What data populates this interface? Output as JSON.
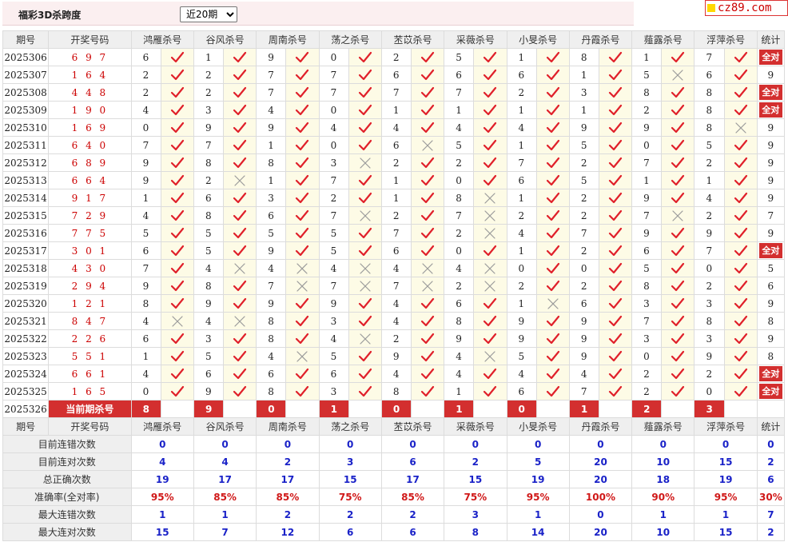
{
  "header": {
    "title": "福彩3D杀跨度",
    "period_selected": "近20期",
    "period_options": [
      "近20期"
    ]
  },
  "logo": {
    "text": "cz89.com"
  },
  "columns": {
    "issue": "期号",
    "code": "开奖号码",
    "experts": [
      "鸿雁杀号",
      "谷风杀号",
      "周南杀号",
      "荡之杀号",
      "苤苡杀号",
      "采薇杀号",
      "小旻杀号",
      "丹霞杀号",
      "薤露杀号",
      "浮萍杀号"
    ],
    "stat": "统计"
  },
  "rows": [
    {
      "issue": "2025306",
      "code": "6 9 7",
      "kills": [
        6,
        1,
        9,
        0,
        2,
        5,
        1,
        8,
        1,
        7
      ],
      "hits": [
        1,
        1,
        1,
        1,
        1,
        1,
        1,
        1,
        1,
        1
      ],
      "stat": "全对"
    },
    {
      "issue": "2025307",
      "code": "1 6 4",
      "kills": [
        2,
        2,
        7,
        7,
        6,
        6,
        6,
        1,
        5,
        6
      ],
      "hits": [
        1,
        1,
        1,
        1,
        1,
        1,
        1,
        1,
        0,
        1
      ],
      "stat": "9"
    },
    {
      "issue": "2025308",
      "code": "4 4 8",
      "kills": [
        2,
        2,
        7,
        7,
        7,
        7,
        2,
        3,
        8,
        8
      ],
      "hits": [
        1,
        1,
        1,
        1,
        1,
        1,
        1,
        1,
        1,
        1
      ],
      "stat": "全对"
    },
    {
      "issue": "2025309",
      "code": "1 9 0",
      "kills": [
        4,
        3,
        4,
        0,
        1,
        1,
        1,
        1,
        2,
        8
      ],
      "hits": [
        1,
        1,
        1,
        1,
        1,
        1,
        1,
        1,
        1,
        1
      ],
      "stat": "全对"
    },
    {
      "issue": "2025310",
      "code": "1 6 9",
      "kills": [
        0,
        9,
        9,
        4,
        4,
        4,
        4,
        9,
        9,
        8
      ],
      "hits": [
        1,
        1,
        1,
        1,
        1,
        1,
        1,
        1,
        1,
        0
      ],
      "stat": "9"
    },
    {
      "issue": "2025311",
      "code": "6 4 0",
      "kills": [
        7,
        7,
        1,
        0,
        6,
        5,
        1,
        5,
        0,
        5
      ],
      "hits": [
        1,
        1,
        1,
        1,
        0,
        1,
        1,
        1,
        1,
        1
      ],
      "stat": "9"
    },
    {
      "issue": "2025312",
      "code": "6 8 9",
      "kills": [
        9,
        8,
        8,
        3,
        2,
        2,
        7,
        2,
        7,
        2
      ],
      "hits": [
        1,
        1,
        1,
        0,
        1,
        1,
        1,
        1,
        1,
        1
      ],
      "stat": "9"
    },
    {
      "issue": "2025313",
      "code": "6 6 4",
      "kills": [
        9,
        2,
        1,
        7,
        1,
        0,
        6,
        5,
        1,
        1
      ],
      "hits": [
        1,
        0,
        1,
        1,
        1,
        1,
        1,
        1,
        1,
        1
      ],
      "stat": "9"
    },
    {
      "issue": "2025314",
      "code": "9 1 7",
      "kills": [
        1,
        6,
        3,
        2,
        1,
        8,
        1,
        2,
        9,
        4
      ],
      "hits": [
        1,
        1,
        1,
        1,
        1,
        0,
        1,
        1,
        1,
        1
      ],
      "stat": "9"
    },
    {
      "issue": "2025315",
      "code": "7 2 9",
      "kills": [
        4,
        8,
        6,
        7,
        2,
        7,
        2,
        2,
        7,
        2
      ],
      "hits": [
        1,
        1,
        1,
        0,
        1,
        0,
        1,
        1,
        0,
        1
      ],
      "stat": "7"
    },
    {
      "issue": "2025316",
      "code": "7 7 5",
      "kills": [
        5,
        5,
        5,
        5,
        7,
        2,
        4,
        7,
        9,
        9
      ],
      "hits": [
        1,
        1,
        1,
        1,
        1,
        0,
        1,
        1,
        1,
        1
      ],
      "stat": "9"
    },
    {
      "issue": "2025317",
      "code": "3 0 1",
      "kills": [
        6,
        5,
        9,
        5,
        6,
        0,
        1,
        2,
        6,
        7
      ],
      "hits": [
        1,
        1,
        1,
        1,
        1,
        1,
        1,
        1,
        1,
        1
      ],
      "stat": "全对"
    },
    {
      "issue": "2025318",
      "code": "4 3 0",
      "kills": [
        7,
        4,
        4,
        4,
        4,
        4,
        0,
        0,
        5,
        0
      ],
      "hits": [
        1,
        0,
        0,
        0,
        0,
        0,
        1,
        1,
        1,
        1
      ],
      "stat": "5"
    },
    {
      "issue": "2025319",
      "code": "2 9 4",
      "kills": [
        9,
        8,
        7,
        7,
        7,
        2,
        2,
        2,
        8,
        2
      ],
      "hits": [
        1,
        1,
        0,
        0,
        0,
        0,
        1,
        1,
        1,
        1
      ],
      "stat": "6"
    },
    {
      "issue": "2025320",
      "code": "1 2 1",
      "kills": [
        8,
        9,
        9,
        9,
        4,
        6,
        1,
        6,
        3,
        3
      ],
      "hits": [
        1,
        1,
        1,
        1,
        1,
        1,
        0,
        1,
        1,
        1
      ],
      "stat": "9"
    },
    {
      "issue": "2025321",
      "code": "8 4 7",
      "kills": [
        4,
        4,
        8,
        3,
        4,
        8,
        9,
        9,
        7,
        8
      ],
      "hits": [
        0,
        0,
        1,
        1,
        1,
        1,
        1,
        1,
        1,
        1
      ],
      "stat": "8"
    },
    {
      "issue": "2025322",
      "code": "2 2 6",
      "kills": [
        6,
        3,
        8,
        4,
        2,
        9,
        9,
        9,
        3,
        3
      ],
      "hits": [
        1,
        1,
        1,
        0,
        1,
        1,
        1,
        1,
        1,
        1
      ],
      "stat": "9"
    },
    {
      "issue": "2025323",
      "code": "5 5 1",
      "kills": [
        1,
        5,
        4,
        5,
        9,
        4,
        5,
        9,
        0,
        9
      ],
      "hits": [
        1,
        1,
        0,
        1,
        1,
        0,
        1,
        1,
        1,
        1
      ],
      "stat": "8"
    },
    {
      "issue": "2025324",
      "code": "6 6 1",
      "kills": [
        4,
        6,
        6,
        6,
        4,
        4,
        4,
        4,
        2,
        2
      ],
      "hits": [
        1,
        1,
        1,
        1,
        1,
        1,
        1,
        1,
        1,
        1
      ],
      "stat": "全对"
    },
    {
      "issue": "2025325",
      "code": "1 6 5",
      "kills": [
        0,
        9,
        8,
        3,
        8,
        1,
        6,
        7,
        2,
        0
      ],
      "hits": [
        1,
        1,
        1,
        1,
        1,
        1,
        1,
        1,
        1,
        1
      ],
      "stat": "全对"
    }
  ],
  "current": {
    "issue": "2025326",
    "label": "当前期杀号",
    "kills": [
      "8",
      "9",
      "0",
      "1",
      "0",
      "1",
      "0",
      "1",
      "2",
      "3"
    ]
  },
  "stats": [
    {
      "label": "目前连错次数",
      "values": [
        "0",
        "0",
        "0",
        "0",
        "0",
        "0",
        "0",
        "0",
        "0",
        "0",
        "0"
      ],
      "color": "blue"
    },
    {
      "label": "目前连对次数",
      "values": [
        "4",
        "4",
        "2",
        "3",
        "6",
        "2",
        "5",
        "20",
        "10",
        "15",
        "2"
      ],
      "color": "blue"
    },
    {
      "label": "总正确次数",
      "values": [
        "19",
        "17",
        "17",
        "15",
        "17",
        "15",
        "19",
        "20",
        "18",
        "19",
        "6"
      ],
      "color": "blue"
    },
    {
      "label": "准确率(全对率)",
      "values": [
        "95%",
        "85%",
        "85%",
        "75%",
        "85%",
        "75%",
        "95%",
        "100%",
        "90%",
        "95%",
        "30%"
      ],
      "color": "red"
    },
    {
      "label": "最大连错次数",
      "values": [
        "1",
        "1",
        "2",
        "2",
        "2",
        "3",
        "1",
        "0",
        "1",
        "1",
        "7"
      ],
      "color": "blue"
    },
    {
      "label": "最大连对次数",
      "values": [
        "15",
        "7",
        "12",
        "6",
        "6",
        "8",
        "14",
        "20",
        "10",
        "15",
        "2"
      ],
      "color": "blue"
    }
  ],
  "colors": {
    "accent": "#d32f2f",
    "check": "#e0202a",
    "cross": "#9a9a9a",
    "mark_bg": "#fdfbe6",
    "header_bg": "#efefef",
    "stat_blue": "#1a22c8",
    "stat_red": "#d01818"
  },
  "icons": {
    "hit": "check-icon",
    "miss": "cross-icon"
  }
}
